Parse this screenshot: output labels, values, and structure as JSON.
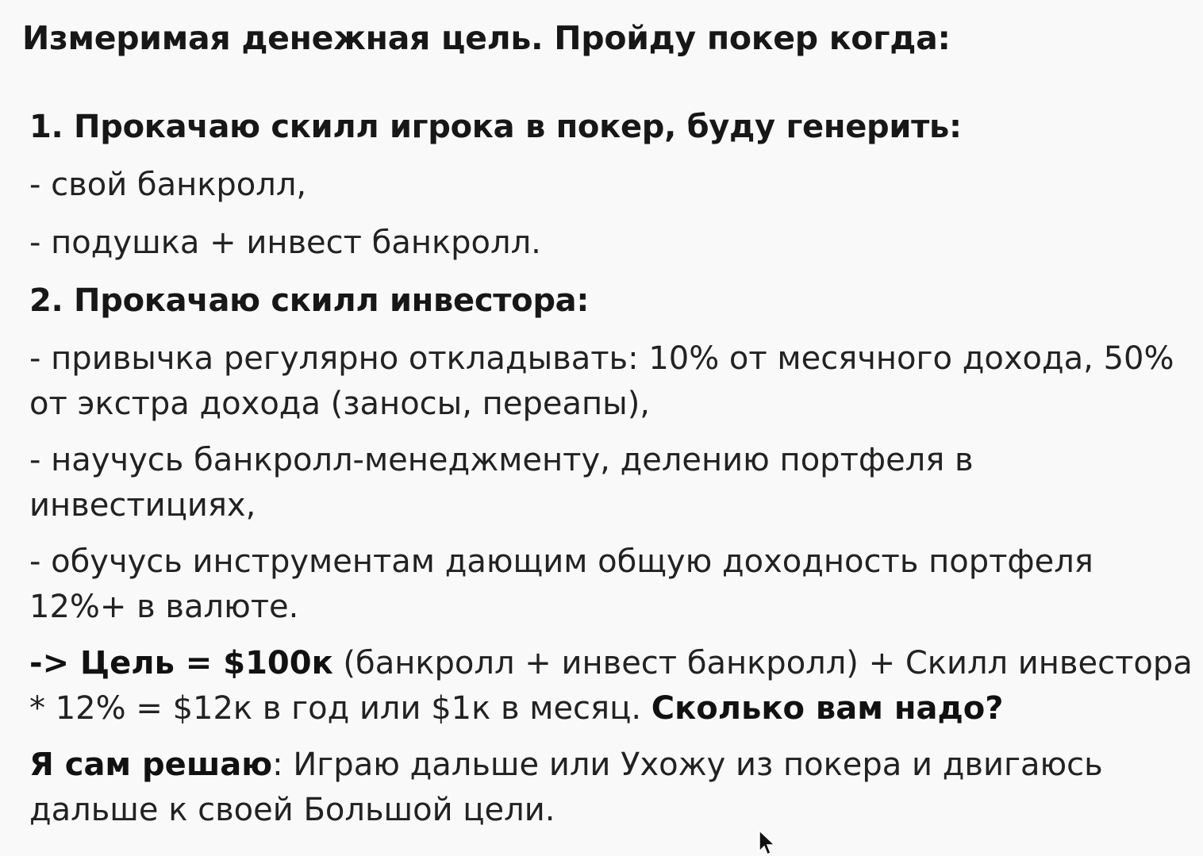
{
  "title": "Измеримая денежная цель. Пройду покер когда:",
  "sections": [
    {
      "heading": "1. Прокачаю скилл игрока в покер, буду генерить:",
      "items": [
        "- свой банкролл,",
        "- подушка + инвест банкролл."
      ]
    },
    {
      "heading": "2. Прокачаю скилл инвестора:",
      "items": [
        "- привычка регулярно откладывать: 10% от месячного дохода, 50% от экстра дохода (заносы, переапы),",
        "- научусь банкролл-менеджменту, делению портфеля в инвестициях,",
        "- обучусь инструментам дающим общую доходность портфеля 12%+ в валюте."
      ]
    }
  ],
  "goal": {
    "bold_prefix": "-> Цель = $100к",
    "text": " (банкролл + инвест банкролл) + Скилл инвестора * 12% = $12к в год или $1к в месяц. ",
    "bold_question": "Сколько вам надо?"
  },
  "decision": {
    "bold_prefix": "Я сам решаю",
    "text": ": Играю дальше или Ухожу из покера и двигаюсь дальше к своей Большой цели."
  },
  "icons": {
    "cursor": "mouse-pointer-icon"
  }
}
